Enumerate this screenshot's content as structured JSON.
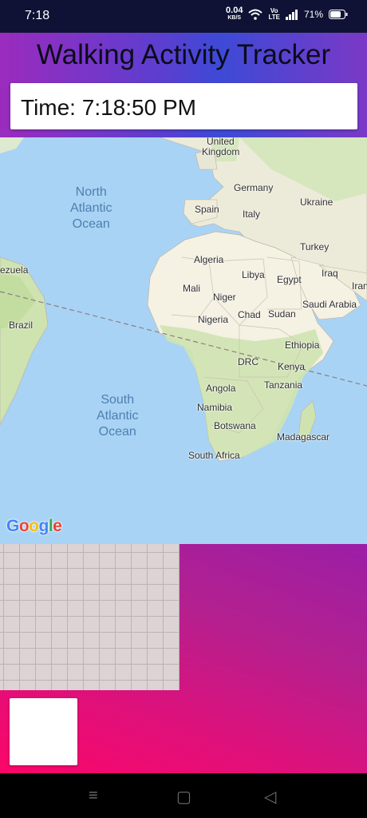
{
  "status_bar": {
    "time": "7:18",
    "net_speed": "0.04",
    "net_speed_unit": "KB/S",
    "volte_top": "Vo",
    "volte_bottom": "LTE",
    "battery": "71%"
  },
  "header": {
    "title": "Walking Activity Tracker",
    "time_display": "Time: 7:18:50 PM"
  },
  "map": {
    "oceans": [
      {
        "line1": "North",
        "line2": "Atlantic",
        "line3": "Ocean"
      },
      {
        "line1": "South",
        "line2": "Atlantic",
        "line3": "Ocean"
      }
    ],
    "labels": {
      "united_kingdom_1": "United",
      "united_kingdom_2": "Kingdom",
      "germany": "Germany",
      "ukraine": "Ukraine",
      "spain": "Spain",
      "italy": "Italy",
      "turkey": "Turkey",
      "algeria": "Algeria",
      "libya": "Libya",
      "egypt": "Egypt",
      "iraq": "Iraq",
      "iran": "Iran",
      "mali": "Mali",
      "niger": "Niger",
      "saudi_arabia": "Saudi Arabia",
      "chad": "Chad",
      "sudan": "Sudan",
      "nigeria": "Nigeria",
      "ethiopia": "Ethiopia",
      "drc": "DRC",
      "kenya": "Kenya",
      "tanzania": "Tanzania",
      "angola": "Angola",
      "namibia": "Namibia",
      "botswana": "Botswana",
      "madagascar": "Madagascar",
      "south_africa": "South Africa",
      "venezuela": "ezuela",
      "brazil": "Brazil"
    },
    "attribution": "Google",
    "colors": {
      "water": "#a9d3f4",
      "land": "#f3efe3",
      "vegetation": "#cfe3b0",
      "desert": "#f6f1e4"
    }
  },
  "nav": {
    "recents_icon": "≡",
    "home_icon": "▢",
    "back_icon": "◁"
  }
}
